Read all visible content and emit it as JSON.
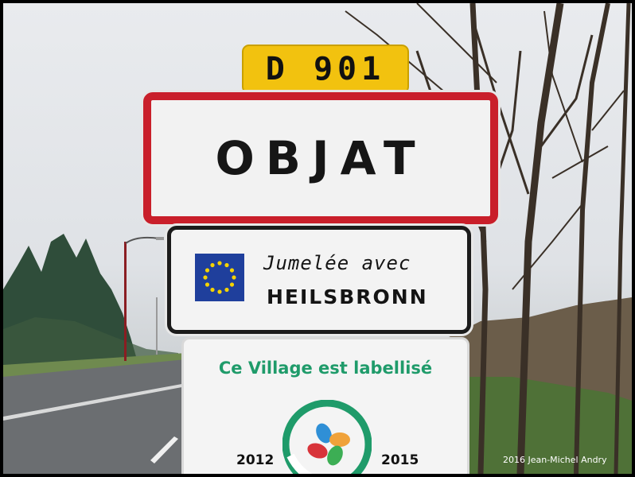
{
  "route_sign": {
    "text": "D 901"
  },
  "town_sign": {
    "text": "OBJAT"
  },
  "twin_sign": {
    "line1": "Jumelée avec",
    "line2": "HEILSBRONN"
  },
  "label_sign": {
    "title": "Ce Village est labellisé",
    "year_start": "2012",
    "year_end": "2015"
  },
  "credit": "2016 Jean-Michel Andry",
  "colors": {
    "route_yellow": "#f2c20f",
    "town_border_red": "#c91f2a",
    "label_green": "#1f9b6a",
    "eu_blue": "#1f3f9c"
  },
  "icons": [
    "eu-flag-icon",
    "flower-logo-icon"
  ]
}
